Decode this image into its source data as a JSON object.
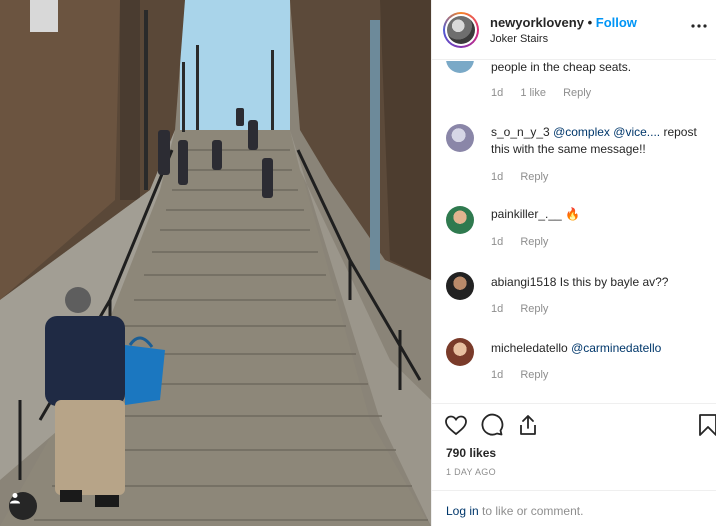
{
  "header": {
    "username": "newyorkloveny",
    "separator": "•",
    "follow_label": "Follow",
    "location": "Joker Stairs",
    "more_icon": "more-horizontal-icon"
  },
  "comments": [
    {
      "username": "",
      "text": "people in the cheap seats.",
      "time": "1d",
      "likes": "1 like",
      "reply": "Reply",
      "avatar_color": "#7aa9c7"
    },
    {
      "username": "s_o_n_y_3",
      "mentions": "@complex @vice....",
      "text": " repost this with the same message!!",
      "time": "1d",
      "reply": "Reply",
      "avatar_color": "#9c9cb8"
    },
    {
      "username": "painkiller_.__",
      "emoji": "🔥",
      "time": "1d",
      "reply": "Reply",
      "avatar_color": "#3b8f5c"
    },
    {
      "username": "abiangi1518",
      "text": "Is this by bayle av??",
      "time": "1d",
      "reply": "Reply",
      "avatar_color": "#2e2a2a"
    },
    {
      "username": "micheledatello",
      "mentions": "@carminedatello",
      "time": "1d",
      "reply": "Reply",
      "avatar_color": "#b0664a"
    }
  ],
  "actions": {
    "like_icon": "heart-icon",
    "comment_icon": "comment-icon",
    "share_icon": "share-icon",
    "save_icon": "bookmark-icon",
    "likes": "790 likes",
    "time_ago": "1 day ago"
  },
  "footer": {
    "login_label": "Log in",
    "rest": " to like or comment."
  },
  "photo": {
    "tag_icon": "user-tag-icon"
  }
}
